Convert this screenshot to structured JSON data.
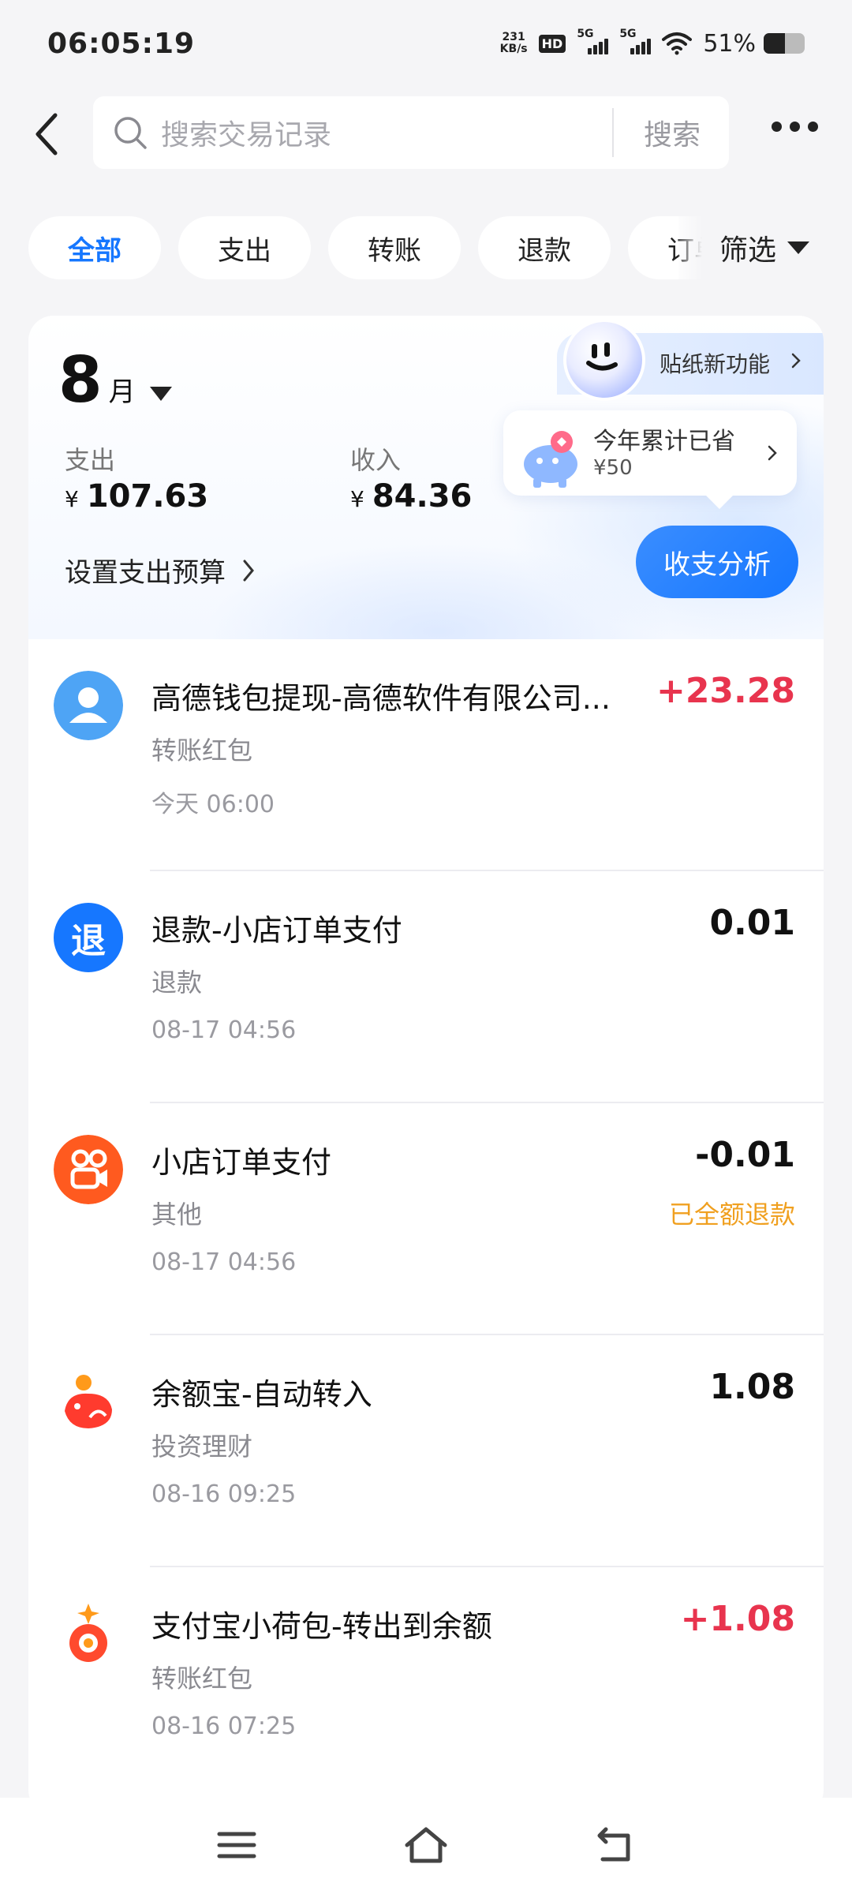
{
  "status_bar": {
    "time": "06:05:19",
    "net_speed_value": "231",
    "net_speed_unit": "KB/s",
    "hd_label": "HD",
    "signal_label_1": "5G",
    "signal_label_2": "5G",
    "battery_percent": "51%",
    "battery_level": 0.51
  },
  "header": {
    "search_placeholder": "搜索交易记录",
    "search_button": "搜索"
  },
  "filters": {
    "tabs": [
      {
        "label": "全部",
        "active": true
      },
      {
        "label": "支出"
      },
      {
        "label": "转账"
      },
      {
        "label": "退款"
      },
      {
        "label": "订单"
      }
    ],
    "filter_label": "筛选"
  },
  "summary": {
    "month_number": "8",
    "month_unit": "月",
    "expense_label": "支出",
    "expense_currency": "¥",
    "expense_value": "107.63",
    "income_label": "收入",
    "income_currency": "¥",
    "income_value": "84.36",
    "sticker_label": "贴纸新功能",
    "saved_title": "今年累计已省",
    "saved_amount": "¥50",
    "budget_label": "设置支出预算",
    "analysis_button": "收支分析"
  },
  "transactions": [
    {
      "title": "高德钱包提现-高德软件有限公司...",
      "category": "转账红包",
      "time": "今天 06:00",
      "amount": "+23.28",
      "note": "",
      "icon": "user-avatar-icon"
    },
    {
      "title": "退款-小店订单支付",
      "category": "退款",
      "time": "08-17 04:56",
      "amount": "0.01",
      "note": "",
      "icon": "refund-icon",
      "icon_text": "退"
    },
    {
      "title": "小店订单支付",
      "category": "其他",
      "time": "08-17 04:56",
      "amount": "-0.01",
      "note": "已全额退款",
      "icon": "kuaishou-shop-icon"
    },
    {
      "title": "余额宝-自动转入",
      "category": "投资理财",
      "time": "08-16 09:25",
      "amount": "1.08",
      "note": "",
      "icon": "yuebao-icon"
    },
    {
      "title": "支付宝小荷包-转出到余额",
      "category": "转账红包",
      "time": "08-16 07:25",
      "amount": "+1.08",
      "note": "",
      "icon": "xiaohebao-icon"
    }
  ],
  "colors": {
    "accent": "#1677ff",
    "income_red": "#e8344e",
    "refund_orange": "#f0a020",
    "background": "#f5f5f7"
  }
}
